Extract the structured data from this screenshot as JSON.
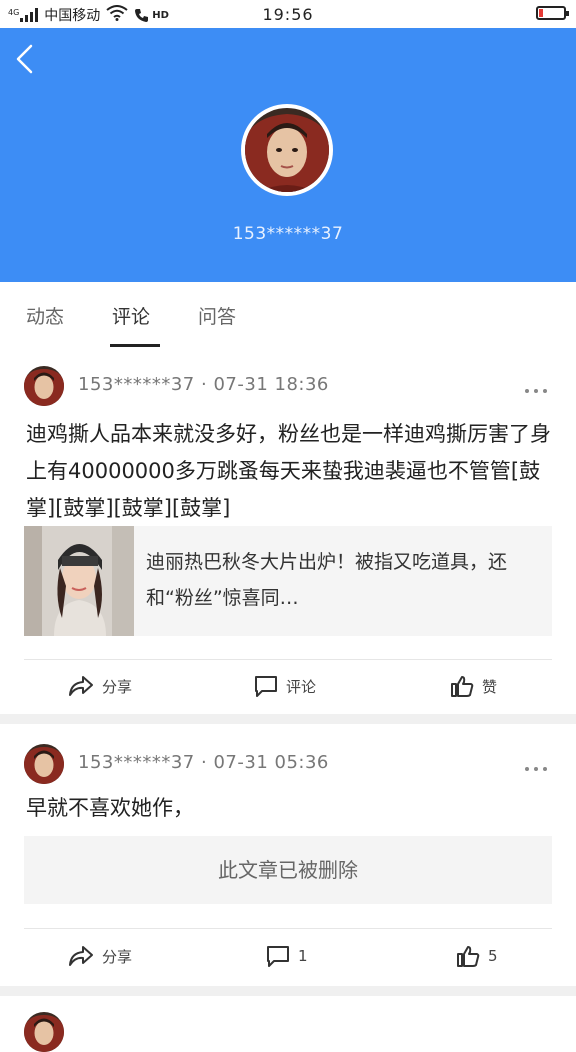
{
  "status_bar": {
    "carrier": "中国移动",
    "time": "19:56",
    "battery_level": 0.15,
    "net_label": "4G",
    "hd_label": "HD",
    "battery_color": "#e53935"
  },
  "header": {
    "phone_masked": "153******37",
    "background_color": "#3d8df5"
  },
  "tabs": [
    {
      "label": "动态"
    },
    {
      "label": "评论"
    },
    {
      "label": "问答"
    }
  ],
  "active_tab": "评论",
  "posts": [
    {
      "author": "153******37",
      "date": "07-31 18:36",
      "separator": "·",
      "text": "迪鸡撕人品本来就没多好，粉丝也是一样迪鸡撕厉害了身上有40000000多万跳蚤每天来蛰我迪裴逼也不管管[鼓掌][鼓掌][鼓掌][鼓掌]",
      "shared_title": "迪丽热巴秋冬大片出炉！被指又吃道具，还和“粉丝”惊喜同…",
      "actions": {
        "share": "分享",
        "comment": "评论",
        "like": "赞"
      }
    },
    {
      "author": "153******37",
      "date": "07-31 05:36",
      "separator": "·",
      "text": "早就不喜欢她作，",
      "deleted_text": "此文章已被删除",
      "actions": {
        "share": "分享",
        "comment": "1",
        "like": "5"
      }
    }
  ],
  "icons": [
    "back-icon",
    "more-icon",
    "share-icon",
    "comment-icon",
    "like-icon",
    "wifi-icon",
    "signal-icon",
    "battery-icon"
  ]
}
